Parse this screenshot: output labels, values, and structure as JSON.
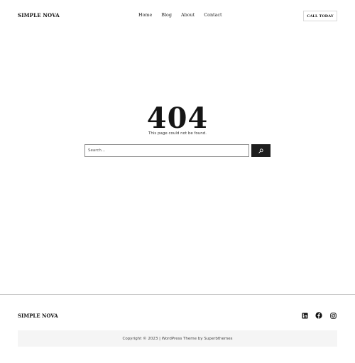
{
  "header": {
    "site_title": "SIMPLE NOVA",
    "nav": [
      {
        "label": "Home"
      },
      {
        "label": "Blog"
      },
      {
        "label": "About"
      },
      {
        "label": "Contact"
      }
    ],
    "cta_label": "CALL TODAY"
  },
  "main": {
    "error_code": "404",
    "error_message": "This page could not be found.",
    "search": {
      "placeholder": "Search...",
      "value": "",
      "button_icon": "search-icon"
    }
  },
  "footer": {
    "site_title": "SIMPLE NOVA",
    "social_icons": [
      "linkedin-icon",
      "facebook-icon",
      "instagram-icon"
    ],
    "copyright": "Copyright © 2023 | WordPress Theme by Superbthemes"
  },
  "colors": {
    "text": "#111111",
    "search_button_bg": "#1e1e1e",
    "copyright_bg": "#f5f5f5",
    "divider": "#c8c8c8"
  }
}
